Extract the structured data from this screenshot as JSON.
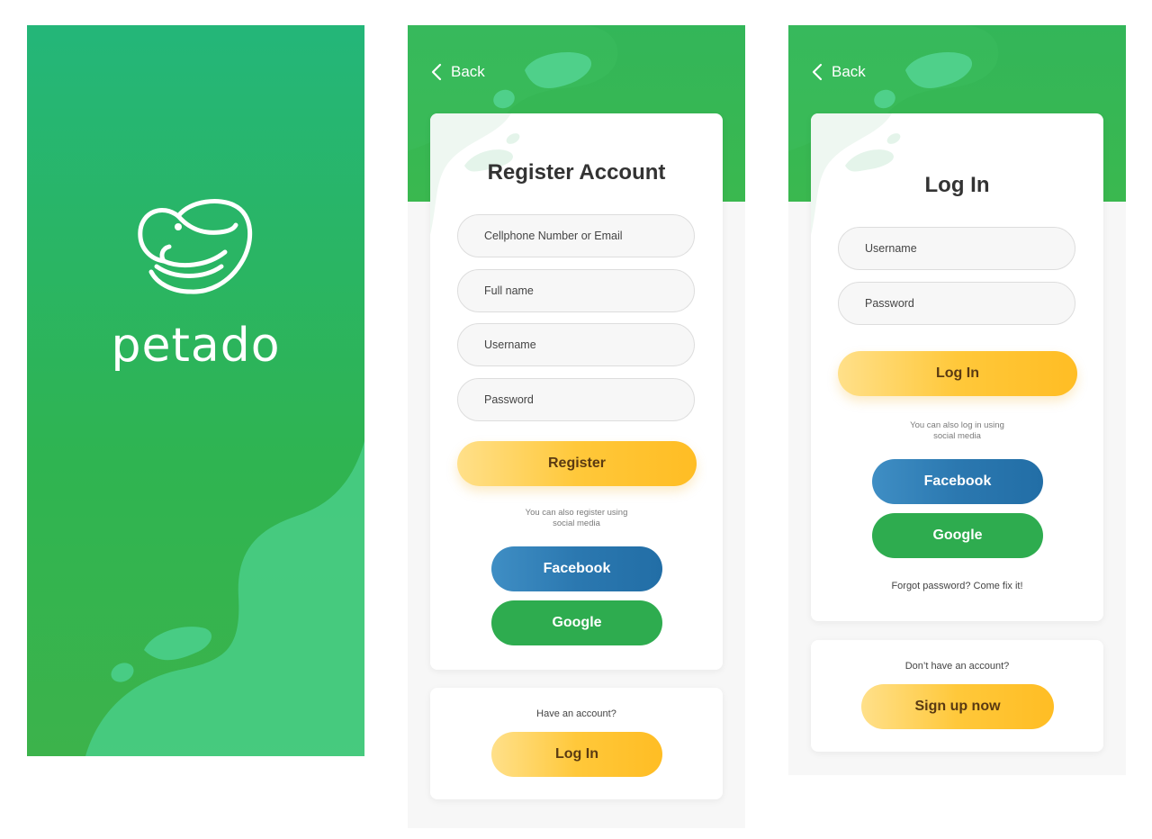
{
  "splash": {
    "brand_name": "petado"
  },
  "register": {
    "back_label": "Back",
    "title": "Register Account",
    "fields": {
      "contact_placeholder": "Cellphone Number or Email",
      "fullname_placeholder": "Full name",
      "username_placeholder": "Username",
      "password_placeholder": "Password"
    },
    "register_button": "Register",
    "social_note_line1": "You can also register using",
    "social_note_line2": "social media",
    "facebook_button": "Facebook",
    "google_button": "Google",
    "have_account_text": "Have an account?",
    "login_button": "Log In"
  },
  "login": {
    "back_label": "Back",
    "title": "Log In",
    "fields": {
      "username_placeholder": "Username",
      "password_placeholder": "Password"
    },
    "login_button": "Log In",
    "social_note_line1": "You can also log in using",
    "social_note_line2": "social media",
    "facebook_button": "Facebook",
    "google_button": "Google",
    "forgot_text": "Forgot password? Come fix it!",
    "no_account_text": "Don’t have an account?",
    "signup_button": "Sign up now"
  },
  "colors": {
    "brand_green": "#2fb451",
    "accent_yellow": "#ffc83a",
    "facebook_blue": "#2b78b0",
    "google_green": "#2eac4f"
  }
}
